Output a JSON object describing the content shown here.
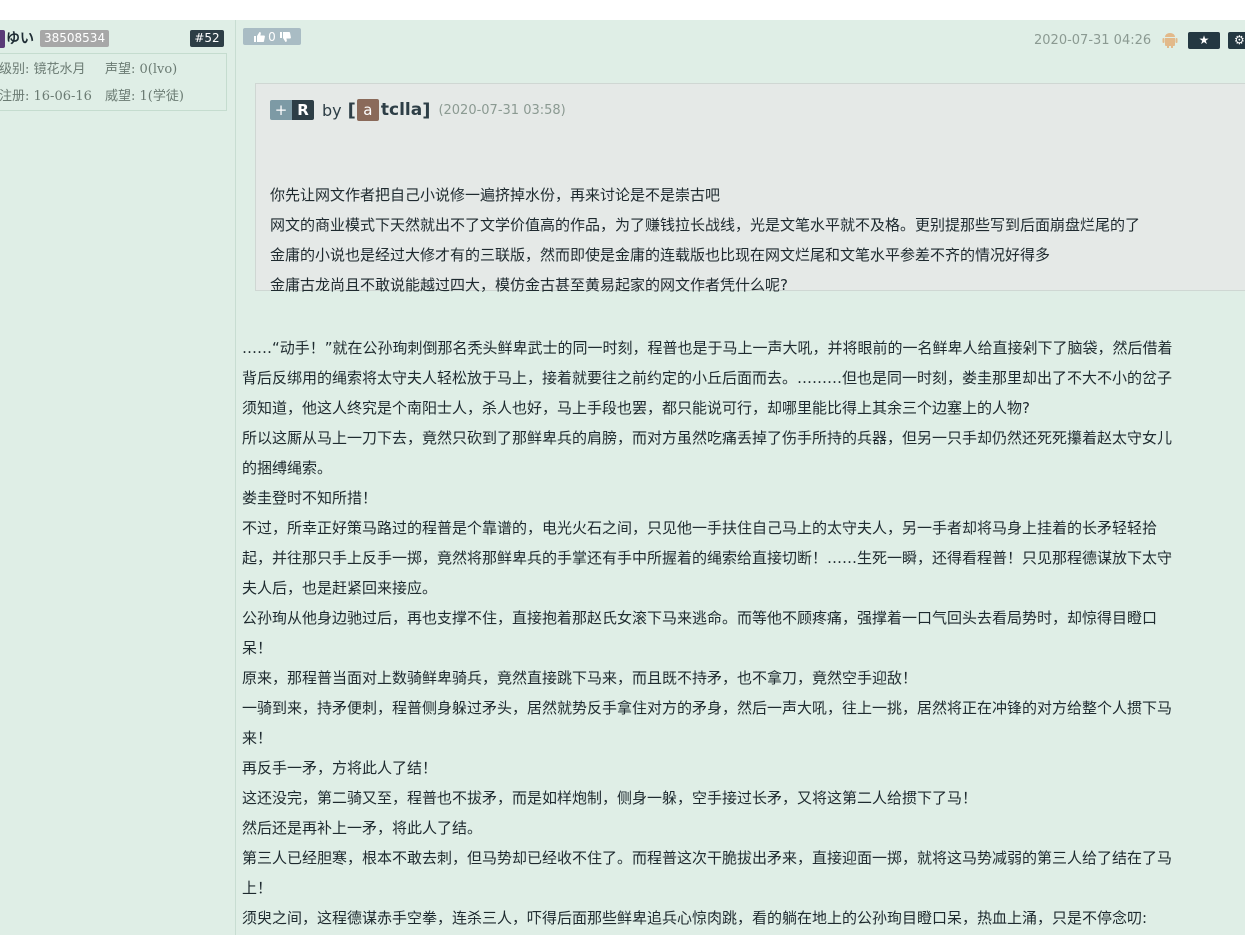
{
  "user": {
    "name": "ゆい",
    "uid": "38508534",
    "floor": "#52",
    "level": "级别: 镜花水月",
    "reputation": "声望: 0(lvo)",
    "register": "注册: 16-06-16",
    "prestige": "威望: 1(学徒)"
  },
  "post": {
    "likes": "0",
    "timestamp": "2020-07-31 04:26",
    "star_label": "★",
    "gear_label": "⚙"
  },
  "quote": {
    "plus": "+",
    "r": "R",
    "by": "by",
    "bracket_open": "[",
    "avatar_letter": "a",
    "author": "tclla",
    "bracket_close": "]",
    "time": "(2020-07-31 03:58)",
    "lines": [
      "你先让网文作者把自己小说修一遍挤掉水份，再来讨论是不是崇古吧",
      "网文的商业模式下天然就出不了文学价值高的作品，为了赚钱拉长战线，光是文笔水平就不及格。更别提那些写到后面崩盘烂尾的了",
      "金庸的小说也是经过大修才有的三联版，然而即使是金庸的连载版也比现在网文烂尾和文笔水平参差不齐的情况好得多",
      "金庸古龙尚且不敢说能越过四大，模仿金古甚至黄易起家的网文作者凭什么呢?"
    ]
  },
  "content": {
    "lines": [
      "……“动手！”就在公孙珣刺倒那名秃头鲜卑武士的同一时刻，程普也是于马上一声大吼，并将眼前的一名鲜卑人给直接剁下了脑袋，然后借着",
      "背后反绑用的绳索将太守夫人轻松放于马上，接着就要往之前约定的小丘后面而去。………但也是同一时刻，娄圭那里却出了不大不小的岔子",
      "须知道，他这人终究是个南阳士人，杀人也好，马上手段也罢，都只能说可行，却哪里能比得上其余三个边塞上的人物?",
      "所以这厮从马上一刀下去，竟然只砍到了那鲜卑兵的肩膀，而对方虽然吃痛丢掉了伤手所持的兵器，但另一只手却仍然还死死攥着赵太守女儿",
      "的捆缚绳索。",
      "娄圭登时不知所措！",
      "不过，所幸正好策马路过的程普是个靠谱的，电光火石之间，只见他一手扶住自己马上的太守夫人，另一手者却将马身上挂着的长矛轻轻拾",
      "起，并往那只手上反手一掷，竟然将那鲜卑兵的手掌还有手中所握着的绳索给直接切断！……生死一瞬，还得看程普！只见那程德谋放下太守",
      "夫人后，也是赶紧回来接应。",
      "公孙珣从他身边驰过后，再也支撑不住，直接抱着那赵氏女滚下马来逃命。而等他不顾疼痛，强撑着一口气回头去看局势时，却惊得目瞪口",
      "呆！",
      "原来，那程普当面对上数骑鲜卑骑兵，竟然直接跳下马来，而且既不持矛，也不拿刀，竟然空手迎敌！",
      "一骑到来，持矛便刺，程普侧身躲过矛头，居然就势反手拿住对方的矛身，然后一声大吼，往上一挑，居然将正在冲锋的对方给整个人掼下马",
      "来！",
      "再反手一矛，方将此人了结！",
      "这还没完，第二骑又至，程普也不拔矛，而是如样炮制，侧身一躲，空手接过长矛，又将这第二人给掼下了马！",
      "然后还是再补上一矛，将此人了结。",
      "第三人已经胆寒，根本不敢去刺，但马势却已经收不住了。而程普这次干脆拔出矛来，直接迎面一掷，就将这马势减弱的第三人给了结在了马",
      "上！",
      "须臾之间，这程德谋赤手空拳，连杀三人，吓得后面那些鲜卑追兵心惊肉跳，看的躺在地上的公孙珣目瞪口呆，热血上涌，只是不停念叨:"
    ]
  }
}
